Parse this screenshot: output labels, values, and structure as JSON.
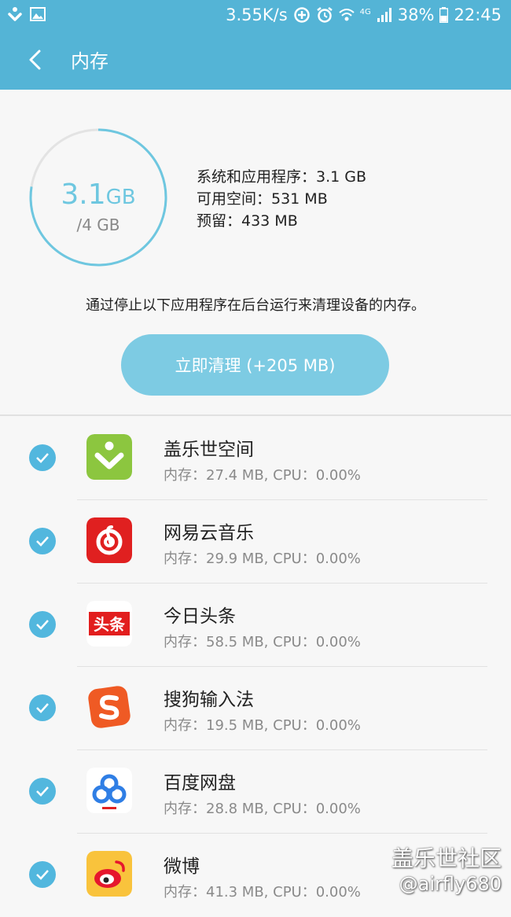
{
  "status_bar": {
    "speed": "3.55K/s",
    "network": "4G",
    "battery": "38%",
    "time": "22:45"
  },
  "header": {
    "title": "内存"
  },
  "memory": {
    "used_value": "3.1",
    "used_unit": "GB",
    "total": "/4 GB",
    "used_fraction": 0.775,
    "stats": [
      "系统和应用程序：3.1 GB",
      "可用空间：531 MB",
      "预留：433 MB"
    ]
  },
  "description": "通过停止以下应用程序在后台运行来清理设备的内存。",
  "clean_button": "立即清理 (+205 MB)",
  "apps": [
    {
      "name": "盖乐世空间",
      "meta": "内存：27.4 MB, CPU：0.00%",
      "icon": "galaxy-space-icon"
    },
    {
      "name": "网易云音乐",
      "meta": "内存：29.9 MB, CPU：0.00%",
      "icon": "netease-music-icon"
    },
    {
      "name": "今日头条",
      "meta": "内存：58.5 MB, CPU：0.00%",
      "icon": "toutiao-icon",
      "icon_text": "头条"
    },
    {
      "name": "搜狗输入法",
      "meta": "内存：19.5 MB, CPU：0.00%",
      "icon": "sogou-input-icon"
    },
    {
      "name": "百度网盘",
      "meta": "内存：28.8 MB, CPU：0.00%",
      "icon": "baidu-netdisk-icon"
    },
    {
      "name": "微博",
      "meta": "内存：41.3 MB, CPU：0.00%",
      "icon": "weibo-icon"
    }
  ],
  "watermark": {
    "line1": "盖乐世社区",
    "line2": "@airfly680"
  },
  "colors": {
    "accent": "#54b4d6",
    "ring": "#6ec7e0",
    "button": "#7dcbe3"
  }
}
